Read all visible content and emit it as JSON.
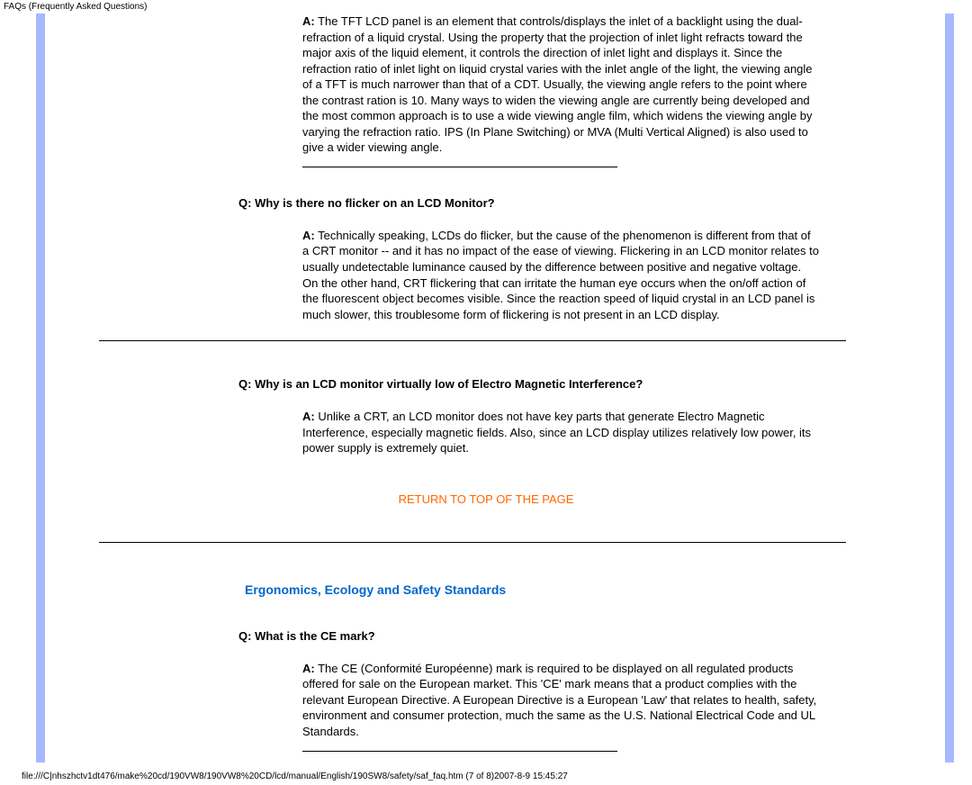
{
  "header": {
    "title": "FAQs (Frequently Asked Questions)"
  },
  "faqs": [
    {
      "a_label": "A:",
      "answer": " The TFT LCD panel is an element that controls/displays the inlet of a backlight using the dual-refraction of a liquid crystal. Using the property that the projection of inlet light refracts toward the major axis of the liquid element, it controls the direction of inlet light and displays it. Since the refraction ratio of inlet light on liquid crystal varies with the inlet angle of the light, the viewing angle of a TFT is much narrower than that of a CDT. Usually, the viewing angle refers to the point where the contrast ration is 10. Many ways to widen the viewing angle are currently being developed and the most common approach is to use a wide viewing angle film, which widens the viewing angle by varying the refraction ratio. IPS (In Plane Switching) or MVA (Multi Vertical Aligned) is also used to give a wider viewing angle."
    },
    {
      "q_label": "Q:",
      "question": " Why is there no flicker on an LCD Monitor?",
      "a_label": "A:",
      "answer": " Technically speaking, LCDs do flicker, but the cause of the phenomenon is different from that of a CRT monitor -- and it has no impact of the ease of viewing. Flickering in an LCD monitor relates to usually undetectable luminance caused by the difference between positive and negative voltage. On the other hand, CRT flickering that can irritate the human eye occurs when the on/off action of the fluorescent object becomes visible. Since the reaction speed of liquid crystal in an LCD panel is much slower, this troublesome form of flickering is not present in an LCD display."
    },
    {
      "q_label": "Q:",
      "question": " Why is an LCD monitor virtually low of Electro Magnetic Interference?",
      "a_label": "A:",
      "answer": " Unlike a CRT, an LCD monitor does not have key parts that generate Electro Magnetic Interference, especially magnetic fields. Also, since an LCD display utilizes relatively low power, its power supply is extremely quiet."
    }
  ],
  "return_link": "RETURN TO TOP OF THE PAGE",
  "section": {
    "heading": "Ergonomics, Ecology and Safety Standards",
    "faq": {
      "q_label": "Q:",
      "question": " What is the CE mark?",
      "a_label": "A:",
      "answer": " The CE (Conformité Européenne) mark is required to be displayed on all regulated products offered for sale on the European market. This 'CE' mark means that a product complies with the relevant European Directive. A European Directive is a European 'Law' that relates to health, safety, environment and consumer protection, much the same as the U.S. National Electrical Code and UL Standards."
    }
  },
  "footer": {
    "path": "file:///C|nhszhctv1dt476/make%20cd/190VW8/190VW8%20CD/lcd/manual/English/190SW8/safety/saf_faq.htm (7 of 8)2007-8-9 15:45:27"
  }
}
